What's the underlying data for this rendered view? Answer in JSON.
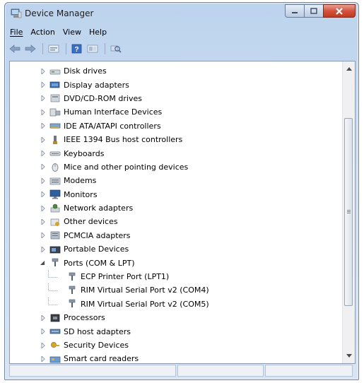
{
  "window": {
    "title": "Device Manager",
    "icon": "device-manager-icon"
  },
  "menu": {
    "file": "File",
    "action": "Action",
    "view": "View",
    "help": "Help"
  },
  "toolbar": {
    "buttons": [
      "back-arrow-icon",
      "forward-arrow-icon",
      "properties-icon",
      "help-icon",
      "show-hidden-icon",
      "scan-hardware-icon"
    ]
  },
  "tree": {
    "items": [
      {
        "label": "Disk drives",
        "icon": "disk-drive-icon",
        "expanded": false,
        "level": 0
      },
      {
        "label": "Display adapters",
        "icon": "display-adapter-icon",
        "expanded": false,
        "level": 0
      },
      {
        "label": "DVD/CD-ROM drives",
        "icon": "dvd-drive-icon",
        "expanded": false,
        "level": 0
      },
      {
        "label": "Human Interface Devices",
        "icon": "hid-icon",
        "expanded": false,
        "level": 0
      },
      {
        "label": "IDE ATA/ATAPI controllers",
        "icon": "ide-controller-icon",
        "expanded": false,
        "level": 0
      },
      {
        "label": "IEEE 1394 Bus host controllers",
        "icon": "firewire-icon",
        "expanded": false,
        "level": 0
      },
      {
        "label": "Keyboards",
        "icon": "keyboard-icon",
        "expanded": false,
        "level": 0
      },
      {
        "label": "Mice and other pointing devices",
        "icon": "mouse-icon",
        "expanded": false,
        "level": 0
      },
      {
        "label": "Modems",
        "icon": "modem-icon",
        "expanded": false,
        "level": 0
      },
      {
        "label": "Monitors",
        "icon": "monitor-icon",
        "expanded": false,
        "level": 0
      },
      {
        "label": "Network adapters",
        "icon": "network-adapter-icon",
        "expanded": false,
        "level": 0
      },
      {
        "label": "Other devices",
        "icon": "other-devices-icon",
        "expanded": false,
        "level": 0
      },
      {
        "label": "PCMCIA adapters",
        "icon": "pcmcia-icon",
        "expanded": false,
        "level": 0
      },
      {
        "label": "Portable Devices",
        "icon": "portable-device-icon",
        "expanded": false,
        "level": 0
      },
      {
        "label": "Ports (COM & LPT)",
        "icon": "port-icon",
        "expanded": true,
        "level": 0
      },
      {
        "label": "ECP Printer Port (LPT1)",
        "icon": "port-icon",
        "level": 1
      },
      {
        "label": "RIM Virtual Serial Port v2 (COM4)",
        "icon": "port-icon",
        "level": 1
      },
      {
        "label": "RIM Virtual Serial Port v2 (COM5)",
        "icon": "port-icon",
        "level": 1
      },
      {
        "label": "Processors",
        "icon": "processor-icon",
        "expanded": false,
        "level": 0
      },
      {
        "label": "SD host adapters",
        "icon": "sd-adapter-icon",
        "expanded": false,
        "level": 0
      },
      {
        "label": "Security Devices",
        "icon": "security-device-icon",
        "expanded": false,
        "level": 0
      },
      {
        "label": "Smart card readers",
        "icon": "smart-card-icon",
        "expanded": false,
        "level": 0
      }
    ]
  },
  "colors": {
    "title_bar": "#c9dbf0",
    "close_button": "#d3533e",
    "selection_border": "#8b9ab0"
  }
}
